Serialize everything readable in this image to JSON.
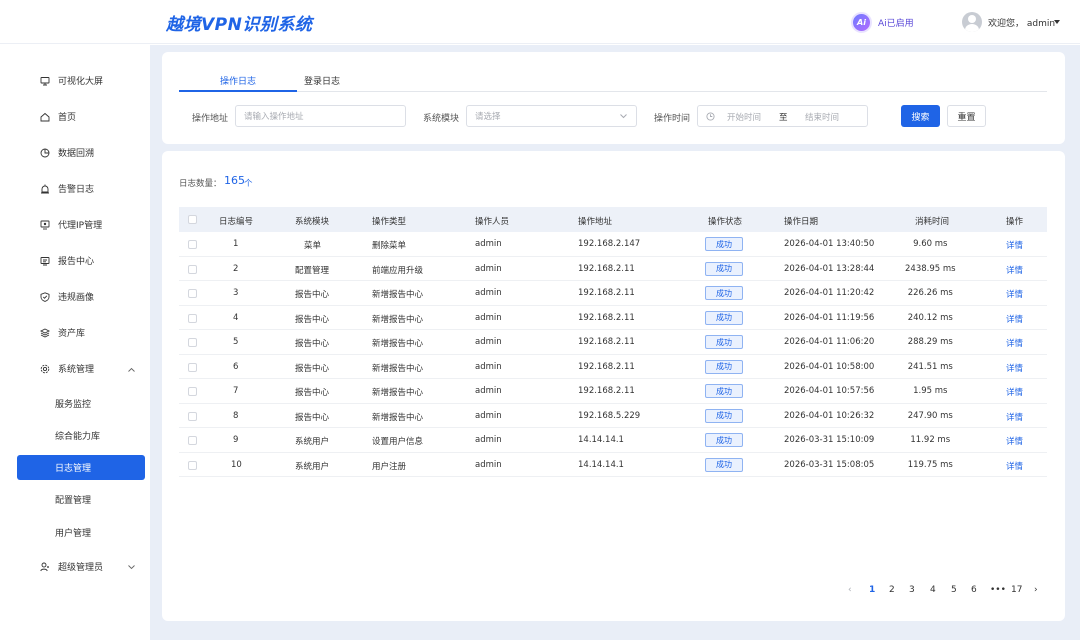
{
  "header": {
    "title": "越境VPN识别系统",
    "ai_badge": "Ai",
    "ai_status": "Ai已启用",
    "welcome": "欢迎您，  admin"
  },
  "sidebar": {
    "items": [
      {
        "label": "可视化大屏",
        "icon": "monitor-icon"
      },
      {
        "label": "首页",
        "icon": "home-icon"
      },
      {
        "label": "数据回溯",
        "icon": "pie-chart-icon"
      },
      {
        "label": "告警日志",
        "icon": "alarm-icon"
      },
      {
        "label": "代理IP管理",
        "icon": "proxy-icon"
      },
      {
        "label": "报告中心",
        "icon": "report-icon"
      },
      {
        "label": "违规画像",
        "icon": "shield-icon"
      },
      {
        "label": "资产库",
        "icon": "layers-icon"
      },
      {
        "label": "系统管理",
        "icon": "gear-icon"
      }
    ],
    "sub_items": [
      "服务监控",
      "综合能力库",
      "日志管理",
      "配置管理",
      "用户管理"
    ],
    "active_sub": "日志管理",
    "super_admin": "超级管理员"
  },
  "tabs": [
    "操作日志",
    "登录日志"
  ],
  "filters": {
    "address_label": "操作地址",
    "address_placeholder": "请输入操作地址",
    "module_label": "系统模块",
    "module_placeholder": "请选择",
    "time_label": "操作时间",
    "start_placeholder": "开始时间",
    "to": "至",
    "end_placeholder": "结束时间",
    "search": "搜索",
    "reset": "重置"
  },
  "summary": {
    "label": "日志数量：",
    "count": "165",
    "unit": "个"
  },
  "table": {
    "columns": [
      "日志编号",
      "系统模块",
      "操作类型",
      "操作人员",
      "操作地址",
      "操作状态",
      "操作日期",
      "消耗时间",
      "操作"
    ],
    "rows": [
      {
        "id": "1",
        "module": "菜单",
        "type": "删除菜单",
        "user": "admin",
        "ip": "192.168.2.147",
        "status": "成功",
        "date": "2026-04-01 13:40:50",
        "cost": "9.60 ms",
        "action": "详情"
      },
      {
        "id": "2",
        "module": "配置管理",
        "type": "前端应用升级",
        "user": "admin",
        "ip": "192.168.2.11",
        "status": "成功",
        "date": "2026-04-01 13:28:44",
        "cost": "2438.95 ms",
        "action": "详情"
      },
      {
        "id": "3",
        "module": "报告中心",
        "type": "新增报告中心",
        "user": "admin",
        "ip": "192.168.2.11",
        "status": "成功",
        "date": "2026-04-01 11:20:42",
        "cost": "226.26 ms",
        "action": "详情"
      },
      {
        "id": "4",
        "module": "报告中心",
        "type": "新增报告中心",
        "user": "admin",
        "ip": "192.168.2.11",
        "status": "成功",
        "date": "2026-04-01 11:19:56",
        "cost": "240.12 ms",
        "action": "详情"
      },
      {
        "id": "5",
        "module": "报告中心",
        "type": "新增报告中心",
        "user": "admin",
        "ip": "192.168.2.11",
        "status": "成功",
        "date": "2026-04-01 11:06:20",
        "cost": "288.29 ms",
        "action": "详情"
      },
      {
        "id": "6",
        "module": "报告中心",
        "type": "新增报告中心",
        "user": "admin",
        "ip": "192.168.2.11",
        "status": "成功",
        "date": "2026-04-01 10:58:00",
        "cost": "241.51 ms",
        "action": "详情"
      },
      {
        "id": "7",
        "module": "报告中心",
        "type": "新增报告中心",
        "user": "admin",
        "ip": "192.168.2.11",
        "status": "成功",
        "date": "2026-04-01 10:57:56",
        "cost": "1.95 ms",
        "action": "详情"
      },
      {
        "id": "8",
        "module": "报告中心",
        "type": "新增报告中心",
        "user": "admin",
        "ip": "192.168.5.229",
        "status": "成功",
        "date": "2026-04-01 10:26:32",
        "cost": "247.90 ms",
        "action": "详情"
      },
      {
        "id": "9",
        "module": "系统用户",
        "type": "设置用户信息",
        "user": "admin",
        "ip": "14.14.14.1",
        "status": "成功",
        "date": "2026-03-31 15:10:09",
        "cost": "11.92 ms",
        "action": "详情"
      },
      {
        "id": "10",
        "module": "系统用户",
        "type": "用户注册",
        "user": "admin",
        "ip": "14.14.14.1",
        "status": "成功",
        "date": "2026-03-31 15:08:05",
        "cost": "119.75 ms",
        "action": "详情"
      }
    ]
  },
  "pagination": {
    "pages": [
      "1",
      "2",
      "3",
      "4",
      "5",
      "6",
      "•••",
      "17"
    ],
    "current": "1",
    "prev": "‹",
    "next": "›"
  }
}
